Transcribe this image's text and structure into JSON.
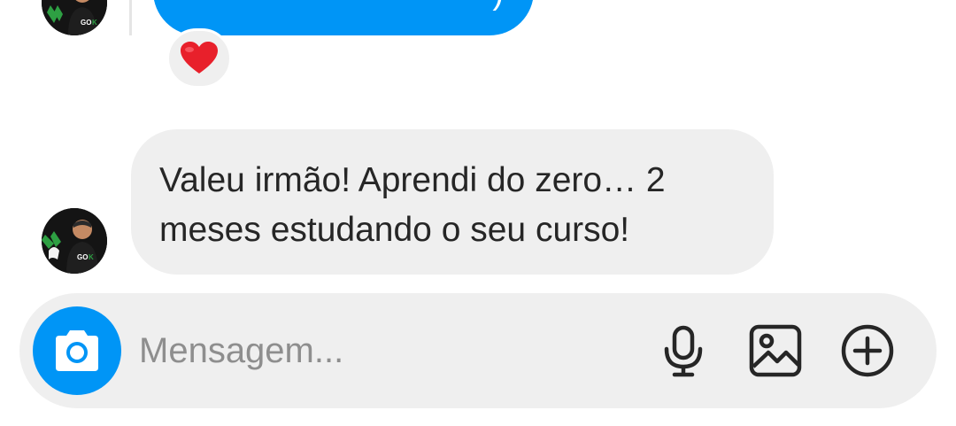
{
  "conversation": {
    "sent_message": {
      "visible_fragment": ")"
    },
    "reaction": {
      "emoji_icon": "red-heart-icon",
      "color": "#e8202b"
    },
    "received_message": {
      "text": "Valeu irmão! Aprendi do zero… 2\nmeses estudando o seu curso!"
    },
    "avatar": {
      "icon": "profile-avatar-icon",
      "badge_text": "GOK"
    }
  },
  "composer": {
    "placeholder": "Mensagem...",
    "value": "",
    "camera_icon": "camera-icon",
    "mic_icon": "microphone-icon",
    "gallery_icon": "gallery-image-icon",
    "plus_icon": "plus-circle-icon"
  },
  "theme": {
    "accent": "#0095f6",
    "bubble_gray": "#efefef",
    "text_dark": "#262626",
    "placeholder_gray": "#8e8e8e"
  }
}
